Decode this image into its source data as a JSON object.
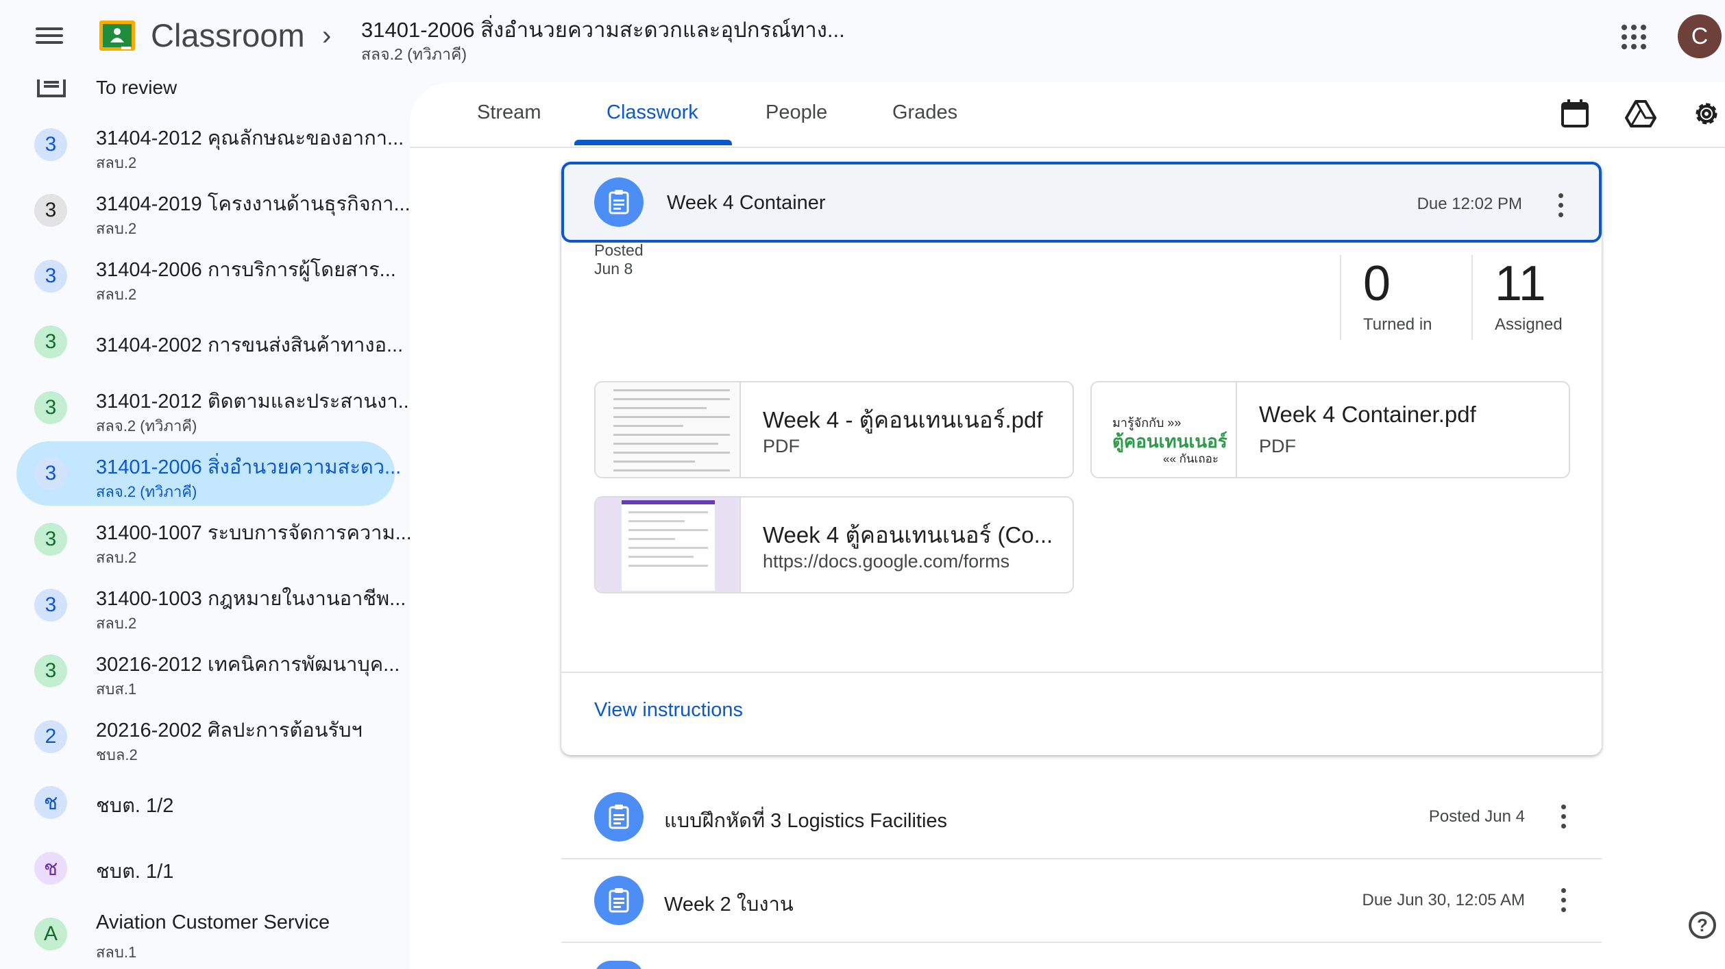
{
  "header": {
    "app_title": "Classroom",
    "breadcrumb_separator": "›",
    "course_title": "31401-2006 สิ่งอำนวยความสะดวกและอุปกรณ์ทาง...",
    "course_subtitle": "สลจ.2 (ทวิภาคี)",
    "avatar_letter": "C"
  },
  "sidebar": {
    "to_review": "To review",
    "classes": [
      {
        "badge": "3",
        "name": "31404-2012 คุณลักษณะของอากา...",
        "sub": "สลบ.2",
        "badge_color": "#0b57d0",
        "badge_bg": "#d3e3fd"
      },
      {
        "badge": "3",
        "name": "31404-2019 โครงงานด้านธุรกิจกา...",
        "sub": "สลบ.2",
        "badge_color": "#1f1f1f",
        "badge_bg": "#e3e3e3"
      },
      {
        "badge": "3",
        "name": "31404-2006 การบริการผู้โดยสาร...",
        "sub": "สลบ.2",
        "badge_color": "#0b57d0",
        "badge_bg": "#d3e3fd"
      },
      {
        "badge": "3",
        "name": "31404-2002 การขนส่งสินค้าทางอ...",
        "sub": "",
        "badge_color": "#146c2e",
        "badge_bg": "#c4eed0"
      },
      {
        "badge": "3",
        "name": "31401-2012 ติดตามและประสานงา...",
        "sub": "สลจ.2 (ทวิภาคี)",
        "badge_color": "#146c2e",
        "badge_bg": "#c4eed0"
      },
      {
        "badge": "3",
        "name": "31401-2006 สิ่งอำนวยความสะดว...",
        "sub": "สลจ.2 (ทวิภาคี)",
        "badge_color": "#0b57d0",
        "badge_bg": "#d3e3fd",
        "selected": true
      },
      {
        "badge": "3",
        "name": "31400-1007 ระบบการจัดการความ...",
        "sub": "สลบ.2",
        "badge_color": "#146c2e",
        "badge_bg": "#c4eed0"
      },
      {
        "badge": "3",
        "name": "31400-1003 กฎหมายในงานอาชีพ...",
        "sub": "สลบ.2",
        "badge_color": "#0b57d0",
        "badge_bg": "#d3e3fd"
      },
      {
        "badge": "3",
        "name": "30216-2012 เทคนิคการพัฒนาบุค...",
        "sub": "สบส.1",
        "badge_color": "#146c2e",
        "badge_bg": "#c4eed0"
      },
      {
        "badge": "2",
        "name": "20216-2002 ศิลปะการต้อนรับฯ",
        "sub": "ชบล.2",
        "badge_color": "#0b57d0",
        "badge_bg": "#d3e3fd"
      },
      {
        "badge": "ช",
        "name": "ชบต. 1/2",
        "sub": "",
        "badge_color": "#0b57d0",
        "badge_bg": "#d3e3fd"
      },
      {
        "badge": "ช",
        "name": "ชบต. 1/1",
        "sub": "",
        "badge_color": "#6e2ea8",
        "badge_bg": "#eaddff"
      },
      {
        "badge": "A",
        "name": "Aviation Customer Service",
        "sub": "สลบ.1",
        "badge_color": "#146c2e",
        "badge_bg": "#c4eed0"
      }
    ]
  },
  "tabs": [
    {
      "label": "Stream"
    },
    {
      "label": "Classwork",
      "active": true
    },
    {
      "label": "People"
    },
    {
      "label": "Grades"
    }
  ],
  "assignment": {
    "title": "Week 4 Container",
    "due": "Due 12:02 PM",
    "posted": "Posted Jun 8",
    "turned_in_count": "0",
    "turned_in_label": "Turned in",
    "assigned_count": "11",
    "assigned_label": "Assigned",
    "attachments": [
      {
        "title": "Week 4 - ตู้คอนเทนเนอร์.pdf",
        "type": "PDF"
      },
      {
        "title": "Week 4 Container.pdf",
        "type": "PDF",
        "thumb_line1": "มารู้จักกับ »»",
        "thumb_line2": "ตู้คอนเทนเนอร์",
        "thumb_line3": "«« กันเถอะ"
      },
      {
        "title": "Week 4 ตู้คอนเทนเนอร์ (Co...",
        "type": "https://docs.google.com/forms"
      }
    ],
    "view_instructions": "View instructions"
  },
  "rows": [
    {
      "title": "แบบฝึกหัดที่ 3 Logistics Facilities",
      "date": "Posted Jun 4"
    },
    {
      "title": "Week 2 ใบงาน",
      "date": "Due Jun 30, 12:05 AM"
    }
  ],
  "colors": {
    "accent": "#0b57d0",
    "selected_bg": "#c2e7ff",
    "assignment_icon": "#4c8df6"
  },
  "icons": [
    "menu-icon",
    "classroom-logo-icon",
    "chevron-right-icon",
    "apps-grid-icon",
    "calendar-icon",
    "drive-icon",
    "settings-gear-icon",
    "assignment-icon",
    "more-vert-icon",
    "help-icon",
    "to-review-icon"
  ]
}
